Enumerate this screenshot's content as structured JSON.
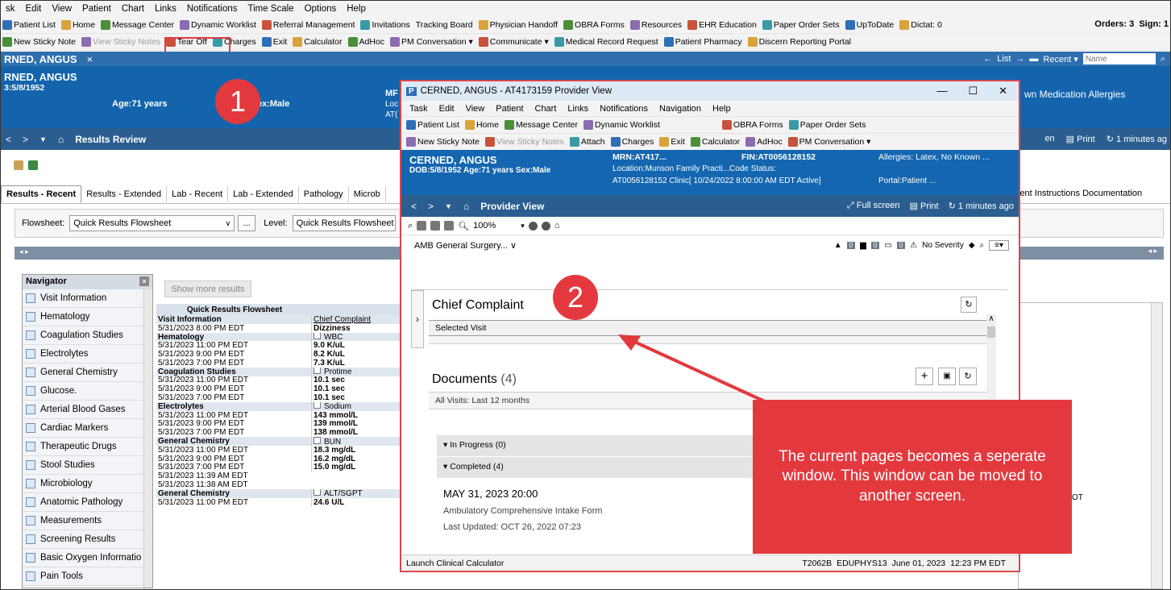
{
  "menu": [
    "sk",
    "Edit",
    "View",
    "Patient",
    "Chart",
    "Links",
    "Notifications",
    "Time Scale",
    "Options",
    "Help"
  ],
  "toolbar1": [
    {
      "label": "Patient List",
      "icon": "list-icon"
    },
    {
      "label": "Home",
      "icon": "home-icon"
    },
    {
      "label": "Message Center",
      "icon": "message-icon"
    },
    {
      "label": "Dynamic Worklist",
      "icon": "worklist-icon"
    },
    {
      "label": "Referral Management",
      "icon": "referral-icon"
    },
    {
      "label": "Invitations",
      "icon": "invite-icon"
    },
    {
      "label": "Tracking Board",
      "icon": ""
    },
    {
      "label": "Physician Handoff",
      "icon": "handoff-icon"
    },
    {
      "label": "OBRA Forms",
      "icon": "obra-icon"
    },
    {
      "label": "Resources",
      "icon": "resources-icon"
    },
    {
      "label": "EHR Education",
      "icon": "education-icon"
    },
    {
      "label": "Paper Order Sets",
      "icon": "paper-icon"
    },
    {
      "label": "UpToDate",
      "icon": "uptodate-icon"
    },
    {
      "label": "Dictat: 0",
      "icon": "dictate-icon"
    }
  ],
  "toolbar1_right": {
    "orders": "Orders: 3",
    "sign": "Sign: 1"
  },
  "toolbar2": [
    {
      "label": "New Sticky Note",
      "icon": "sticky-note-icon"
    },
    {
      "label": "View Sticky Notes",
      "icon": "view-notes-icon",
      "disabled": true
    },
    {
      "label": "Tear Off",
      "icon": "tear-off-icon",
      "highlight": true
    },
    {
      "label": "Charges",
      "icon": "charges-icon"
    },
    {
      "label": "Exit",
      "icon": "exit-icon"
    },
    {
      "label": "Calculator",
      "icon": "calculator-icon"
    },
    {
      "label": "AdHoc",
      "icon": "adhoc-icon"
    },
    {
      "label": "PM Conversation ▾",
      "icon": "pm-icon"
    },
    {
      "label": "Communicate ▾",
      "icon": "communicate-icon"
    },
    {
      "label": "Medical Record Request",
      "icon": "record-icon"
    },
    {
      "label": "Patient Pharmacy",
      "icon": "pharmacy-icon"
    },
    {
      "label": "Discern Reporting Portal",
      "icon": "discern-icon"
    }
  ],
  "patient_tab": {
    "name": "RNED, ANGUS",
    "close": "×"
  },
  "nav_right": {
    "list": "List",
    "recent": "Recent ▾",
    "name_placeholder": "Name"
  },
  "patient": {
    "name": "RNED, ANGUS",
    "dob": "3:5/8/1952",
    "age": "Age:71 years",
    "sex": "ex:Male",
    "mrn_partial": "MF",
    "loc_partial": "Loc",
    "at_partial": "AT(",
    "allergies_partial": "wn Medication Allergies"
  },
  "results": {
    "title": "Results Review",
    "screen_partial": "en",
    "print": "Print",
    "ago": "1 minutes ag"
  },
  "tabs": [
    "Results - Recent",
    "Results - Extended",
    "Lab - Recent",
    "Lab - Extended",
    "Pathology",
    "Microb"
  ],
  "tab_right": "ient Instructions Documentation",
  "flowsheet": {
    "label": "Flowsheet:",
    "value": "Quick Results Flowsheet",
    "more": "...",
    "level_label": "Level:",
    "level_value": "Quick Results Flowsheet"
  },
  "navigator": {
    "title": "Navigator",
    "items": [
      "Visit Information",
      "Hematology",
      "Coagulation Studies",
      "Electrolytes",
      "General Chemistry",
      "Glucose.",
      "Arterial Blood Gases",
      "Cardiac Markers",
      "Therapeutic Drugs",
      "Stool Studies",
      "Microbiology",
      "Anatomic Pathology",
      "Measurements",
      "Screening Results",
      "Basic Oxygen Informatio",
      "Pain Tools"
    ]
  },
  "show_more": "Show more results",
  "grid": {
    "header": "Quick Results Flowsheet",
    "rows": [
      {
        "a": "Visit Information",
        "b": "Chief Complaint",
        "h": true,
        "u": true
      },
      {
        "a": "5/31/2023 8:00 PM EDT",
        "b": "Dizziness"
      },
      {
        "a": "Hematology",
        "b": "WBC",
        "h": true,
        "c": true
      },
      {
        "a": "5/31/2023 11:00 PM EDT",
        "b": "9.0 K/uL"
      },
      {
        "a": "5/31/2023 9:00 PM EDT",
        "b": "8.2 K/uL"
      },
      {
        "a": "5/31/2023 7:00 PM EDT",
        "b": "7.3 K/uL"
      },
      {
        "a": "Coagulation Studies",
        "b": "Protime",
        "h": true,
        "c": true
      },
      {
        "a": "5/31/2023 11:00 PM EDT",
        "b": "10.1 sec"
      },
      {
        "a": "5/31/2023 9:00 PM EDT",
        "b": "10.1 sec"
      },
      {
        "a": "5/31/2023 7:00 PM EDT",
        "b": "10.1 sec"
      },
      {
        "a": "Electrolytes",
        "b": "Sodium",
        "h": true,
        "c": true
      },
      {
        "a": "5/31/2023 11:00 PM EDT",
        "b": "143 mmol/L"
      },
      {
        "a": "5/31/2023 9:00 PM EDT",
        "b": "139 mmol/L"
      },
      {
        "a": "5/31/2023 7:00 PM EDT",
        "b": "138 mmol/L"
      },
      {
        "a": "General Chemistry",
        "b": "BUN",
        "h": true,
        "c": true
      },
      {
        "a": "5/31/2023 11:00 PM EDT",
        "b": "18.3 mg/dL"
      },
      {
        "a": "5/31/2023 9:00 PM EDT",
        "b": "16.2 mg/dL"
      },
      {
        "a": "5/31/2023 7:00 PM EDT",
        "b": "15.0 mg/dL"
      },
      {
        "a": "5/31/2023 11:39 AM EDT",
        "b": ""
      },
      {
        "a": "5/31/2023 11:38 AM EDT",
        "b": ""
      },
      {
        "a": "General Chemistry",
        "b": "ALT/SGPT",
        "h": true,
        "c": true
      },
      {
        "a": "5/31/2023 11:00 PM EDT",
        "b": "24.6 U/L"
      }
    ]
  },
  "right_grid_partial": "OT",
  "window": {
    "title": "CERNED, ANGUS - AT4173159 Provider View",
    "controls": [
      "—",
      "☐",
      "✕"
    ],
    "menu": [
      "Task",
      "Edit",
      "View",
      "Patient",
      "Chart",
      "Links",
      "Notifications",
      "Navigation",
      "Help"
    ],
    "toolbar1": [
      "Patient List",
      "Home",
      "Message Center",
      "Dynamic Worklist",
      "OBRA Forms",
      "Paper Order Sets"
    ],
    "toolbar2": [
      "New Sticky Note",
      "View Sticky Notes",
      "Attach",
      "Charges",
      "Exit",
      "Calculator",
      "AdHoc",
      "PM Conversation ▾"
    ],
    "patient": {
      "name": "CERNED, ANGUS",
      "dob": "DOB:5/8/1952  Age:71 years   Sex:Male",
      "mrn": "MRN:AT417...",
      "fin": "FIN:AT0056128152",
      "allergies": "Allergies: Latex, No Known ...",
      "location": "Location:Munson Family Practi...Code Status:",
      "visit": "AT0056128152 Clinic[ 10/24/2022 8:00:00 AM EDT Active]",
      "portal": "Portal:Patient ..."
    },
    "nav": {
      "title": "Provider View",
      "full": "Full screen",
      "print": "Print",
      "ago": "1 minutes ago"
    },
    "zoom": "100%",
    "dropdown": "AMB General Surgery...",
    "counts": [
      "0",
      "0",
      "0"
    ],
    "severity": "No Severity",
    "chief": {
      "title": "Chief Complaint",
      "sub": "Selected Visit"
    },
    "documents": {
      "title": "Documents",
      "count": "(4)",
      "filter": "All Visits: Last 12 months",
      "in_progress": "In Progress (0)",
      "completed": "Completed (4)",
      "date": "MAY 31, 2023 20:00",
      "form": "Ambulatory Comprehensive Intake Form",
      "updated": "Last Updated: OCT 26, 2022 07:23"
    },
    "status": {
      "left": "Launch Clinical Calculator",
      "code": "T2062B",
      "user": "EDUPHYS13",
      "date": "June 01, 2023",
      "time": "12:23 PM EDT"
    }
  },
  "annotations": {
    "one": "1",
    "two": "2",
    "callout": "The current pages becomes a seperate window. This window can be moved to another screen."
  },
  "colors": {
    "accent_red": "#e3393e",
    "header_blue": "#1464ad",
    "nav_blue": "#2a5e90"
  }
}
